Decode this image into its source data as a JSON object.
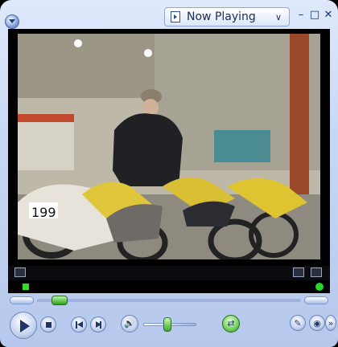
{
  "window": {
    "now_playing_label": "Now Playing",
    "dropdown_chevron": "∨",
    "minimize_glyph": "–",
    "maximize_glyph": "□",
    "close_glyph": "✕"
  },
  "icons": {
    "menu": "menu-orb-icon",
    "now_playing": "now-playing-icon",
    "video_left": "fullscreen-icon",
    "video_right_1": "switch-view-icon",
    "video_right_2": "switch-to-skin-icon",
    "play": "play-icon",
    "stop": "stop-icon",
    "previous": "previous-icon",
    "next": "next-icon",
    "mute": "speaker-icon",
    "fast_forward": "fast-forward-icon"
  },
  "seek": {
    "position": 0.06
  },
  "volume": {
    "level": 0.45
  },
  "colors": {
    "accent_green": "#38d82b",
    "skin_blue": "#c7d7f4",
    "frame_black": "#000000"
  },
  "transport_glyphs": {
    "mute": "🔊",
    "fast_forward": "⇄",
    "r1": "✎",
    "r2": "◉",
    "r3": "»"
  }
}
